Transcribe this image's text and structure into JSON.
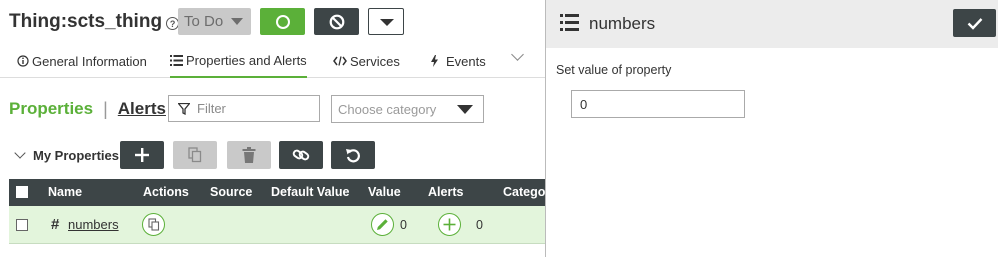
{
  "header": {
    "thing_label": "Thing:",
    "thing_name": "scts_thing",
    "help_glyph": "?",
    "state_label": "To Do"
  },
  "tabs": [
    {
      "label": "General Information",
      "icon": "info-circle-icon"
    },
    {
      "label": "Properties and Alerts",
      "icon": "list-icon",
      "active": true
    },
    {
      "label": "Services",
      "icon": "code-icon"
    },
    {
      "label": "Events",
      "icon": "bolt-icon"
    }
  ],
  "subheader": {
    "properties_label": "Properties",
    "separator": "|",
    "alerts_label": "Alerts",
    "filter_placeholder": "Filter",
    "category_placeholder": "Choose category"
  },
  "my_properties": {
    "label": "My Properties"
  },
  "grid": {
    "columns": [
      "Name",
      "Actions",
      "Source",
      "Default Value",
      "Value",
      "Alerts",
      "Catego"
    ],
    "rows": [
      {
        "hash": "#",
        "name": "numbers",
        "value": "0",
        "alerts": "0"
      }
    ]
  },
  "panel": {
    "title": "numbers",
    "field_label": "Set value of property",
    "field_value": "0"
  },
  "colors": {
    "accent_green": "#5bb039",
    "dark": "#3d4547",
    "disabled": "#c9c9c9",
    "row_selected": "#e3f5dc"
  }
}
